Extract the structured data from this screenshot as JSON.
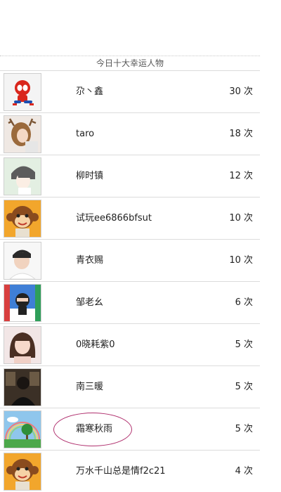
{
  "section": {
    "title": "今日十大幸运人物"
  },
  "rows": [
    {
      "name": "尕丶鑫",
      "count": "30 次",
      "avatar_icon": "spiderman-avatar-icon"
    },
    {
      "name": "taro",
      "count": "18 次",
      "avatar_icon": "girl-antlers-avatar-icon"
    },
    {
      "name": "柳时镇",
      "count": "12 次",
      "avatar_icon": "anime-boy-avatar-icon"
    },
    {
      "name": "试玩ee6866bfsut",
      "count": "10 次",
      "avatar_icon": "monkey-avatar-icon"
    },
    {
      "name": "青衣赐",
      "count": "10 次",
      "avatar_icon": "young-man-avatar-icon"
    },
    {
      "name": "邹老幺",
      "count": "6 次",
      "avatar_icon": "ninja-game-avatar-icon"
    },
    {
      "name": "0晓耗紫0",
      "count": "5 次",
      "avatar_icon": "girl-photo-avatar-icon"
    },
    {
      "name": "南三暖",
      "count": "5 次",
      "avatar_icon": "dark-room-avatar-icon"
    },
    {
      "name": "霜寒秋雨",
      "count": "5 次",
      "avatar_icon": "rainbow-tree-avatar-icon"
    },
    {
      "name": "万水千山总是情f2c21",
      "count": "4 次",
      "avatar_icon": "monkey-avatar-icon"
    }
  ]
}
